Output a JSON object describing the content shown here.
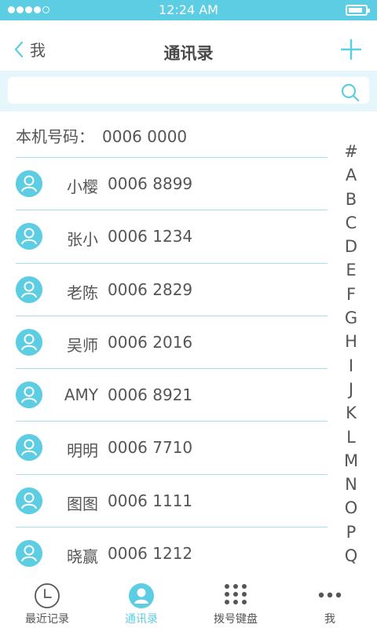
{
  "status": {
    "time": "12:24 AM",
    "signal_bars": 4,
    "battery_level": 0.85
  },
  "nav": {
    "back_label": "我",
    "title": "通讯录",
    "add_icon": "plus-icon"
  },
  "search": {
    "placeholder": "",
    "icon": "search-icon"
  },
  "my_number": {
    "label": "本机号码：",
    "value": "0006 0000"
  },
  "contacts": [
    {
      "name": "小樱",
      "phone": "0006 8899"
    },
    {
      "name": "张小",
      "phone": "0006 1234"
    },
    {
      "name": "老陈",
      "phone": "0006 2829"
    },
    {
      "name": "吴师",
      "phone": "0006 2016"
    },
    {
      "name": "AMY",
      "phone": "0006 8921"
    },
    {
      "name": "明明",
      "phone": "0006 7710"
    },
    {
      "name": "图图",
      "phone": "0006 1111"
    },
    {
      "name": "晓赢",
      "phone": "0006 1212"
    }
  ],
  "index_letters": [
    "#",
    "A",
    "B",
    "C",
    "D",
    "E",
    "F",
    "G",
    "H",
    "I",
    "J",
    "K",
    "L",
    "M",
    "N",
    "O",
    "P",
    "Q"
  ],
  "tabs": [
    {
      "label": "最近记录",
      "icon": "clock-icon",
      "active": false
    },
    {
      "label": "通讯录",
      "icon": "contact-icon",
      "active": true
    },
    {
      "label": "拨号键盘",
      "icon": "keypad-icon",
      "active": false
    },
    {
      "label": "我",
      "icon": "more-icon",
      "active": false
    }
  ],
  "colors": {
    "accent": "#5ccde3",
    "text": "#555555",
    "divider": "#a8dfea",
    "search_bg": "#e6f7fb"
  }
}
